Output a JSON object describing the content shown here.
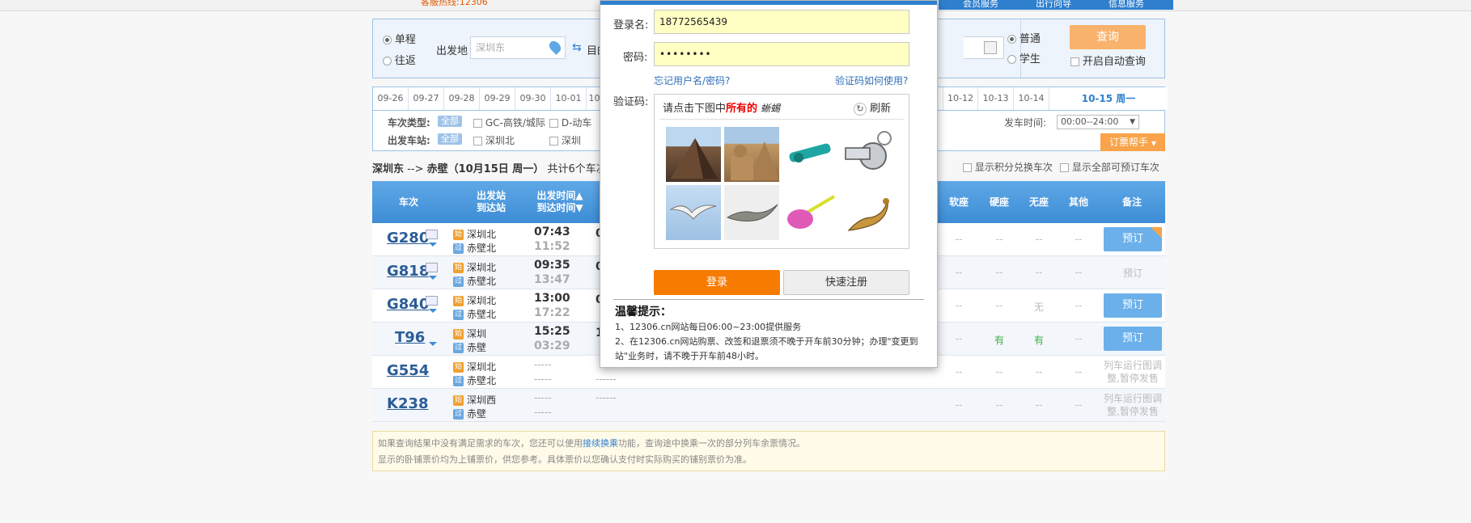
{
  "topbar": {
    "hotline": "客服热线:12306",
    "nav": [
      "会员服务",
      "出行向导",
      "信息服务"
    ]
  },
  "search": {
    "oneway": "单程",
    "roundtrip": "往返",
    "from_label": "出发地",
    "from_value": "深圳东",
    "to_label_partial": "目的",
    "passenger_normal": "普通",
    "passenger_student": "学生",
    "query_button": "查询",
    "auto_query": "开启自动查询"
  },
  "dates": [
    "09-26",
    "09-27",
    "09-28",
    "09-29",
    "09-30",
    "10-01",
    "10"
  ],
  "dates_right": [
    "10-12",
    "10-13",
    "10-14"
  ],
  "active_date": "10-15 周一",
  "filters": {
    "type_label": "车次类型:",
    "all": "全部",
    "gc": "GC-高铁/城际",
    "d": "D-动车",
    "station_label": "出发车站:",
    "st1": "深圳北",
    "st2": "深圳",
    "time_label": "发车时间:",
    "time_value": "00:00--24:00",
    "helper": "订票帮手"
  },
  "route": {
    "from": "深圳东",
    "arrow": "-->",
    "to": "赤壁",
    "date": "（10月15日 周一）",
    "count": "共计6个车次",
    "show_points": "显示积分兑换车次",
    "show_all": "显示全部可预订车次"
  },
  "table": {
    "headers": {
      "train": "车次",
      "station_a": "出发站",
      "station_b": "到达站",
      "time_a": "出发时间▲",
      "time_b": "到达时间▼",
      "soft_seat": "软座",
      "hard_seat": "硬座",
      "no_seat": "无座",
      "other": "其他",
      "remark": "备注"
    },
    "rows": [
      {
        "train": "G280",
        "from": "深圳北",
        "to": "赤壁北",
        "dep": "07:43",
        "arr": "11:52",
        "col1": "0",
        "c1": "--",
        "c2": "--",
        "c3": "--",
        "c4": "--",
        "book": "预订"
      },
      {
        "train": "G818",
        "from": "深圳北",
        "to": "赤壁北",
        "dep": "09:35",
        "arr": "13:47",
        "col1": "0",
        "c1": "--",
        "c2": "--",
        "c3": "--",
        "c4": "--",
        "book": "预订"
      },
      {
        "train": "G840",
        "from": "深圳北",
        "to": "赤壁北",
        "dep": "13:00",
        "arr": "17:22",
        "col1": "0",
        "c1": "--",
        "c2": "--",
        "c3": "无",
        "c4": "--",
        "book": "预订"
      },
      {
        "train": "T96",
        "from": "深圳",
        "to": "赤壁",
        "dep": "15:25",
        "arr": "03:29",
        "col1": "1",
        "c1": "--",
        "c2": "有",
        "c3": "有",
        "c4": "--",
        "book": "预订"
      },
      {
        "train": "G554",
        "from": "深圳北",
        "to": "赤壁北",
        "dep": "-----",
        "arr": "-----",
        "col1": "------",
        "c1": "--",
        "c2": "--",
        "c3": "--",
        "c4": "--",
        "book": "列车运行图调整,暂停发售"
      },
      {
        "train": "K238",
        "from": "深圳西",
        "to": "赤壁",
        "dep": "-----",
        "arr": "-----",
        "col1": "------",
        "c1": "--",
        "c2": "--",
        "c3": "--",
        "c4": "--",
        "book": "列车运行图调整,暂停发售"
      }
    ]
  },
  "footnote": {
    "line1_a": "如果查询结果中没有满足需求的车次，您还可以使用",
    "line1_link": "接续换乘",
    "line1_b": "功能，查询途中换乘一次的部分列车余票情况。",
    "line2": "显示的卧铺票价均为上铺票价，供您参考。具体票价以您确认支付时实际购买的铺别票价为准。"
  },
  "login": {
    "user_label": "登录名:",
    "user_value": "18772565439",
    "pwd_label": "密码:",
    "pwd_value": "••••••••",
    "forgot": "忘记用户名/密码?",
    "captcha_help": "验证码如何使用?",
    "captcha_label": "验证码:",
    "captcha_prompt_a": "请点击下图中",
    "captcha_prompt_b": "所有的",
    "captcha_word": "蜥蜴",
    "refresh": "刷新",
    "login_button": "登录",
    "register_button": "快速注册",
    "tips_title": "温馨提示：",
    "tip1": "1、12306.cn网站每日06:00~23:00提供服务",
    "tip2": "2、在12306.cn网站购票、改签和退票须不晚于开车前30分钟；办理\"变更到站\"业务时，请不晚于开车前48小时。"
  },
  "colors": {
    "brand_blue": "#2f7fcf",
    "orange": "#f77b00",
    "book_blue": "#6bb0ea",
    "available_green": "#3bb34a"
  }
}
